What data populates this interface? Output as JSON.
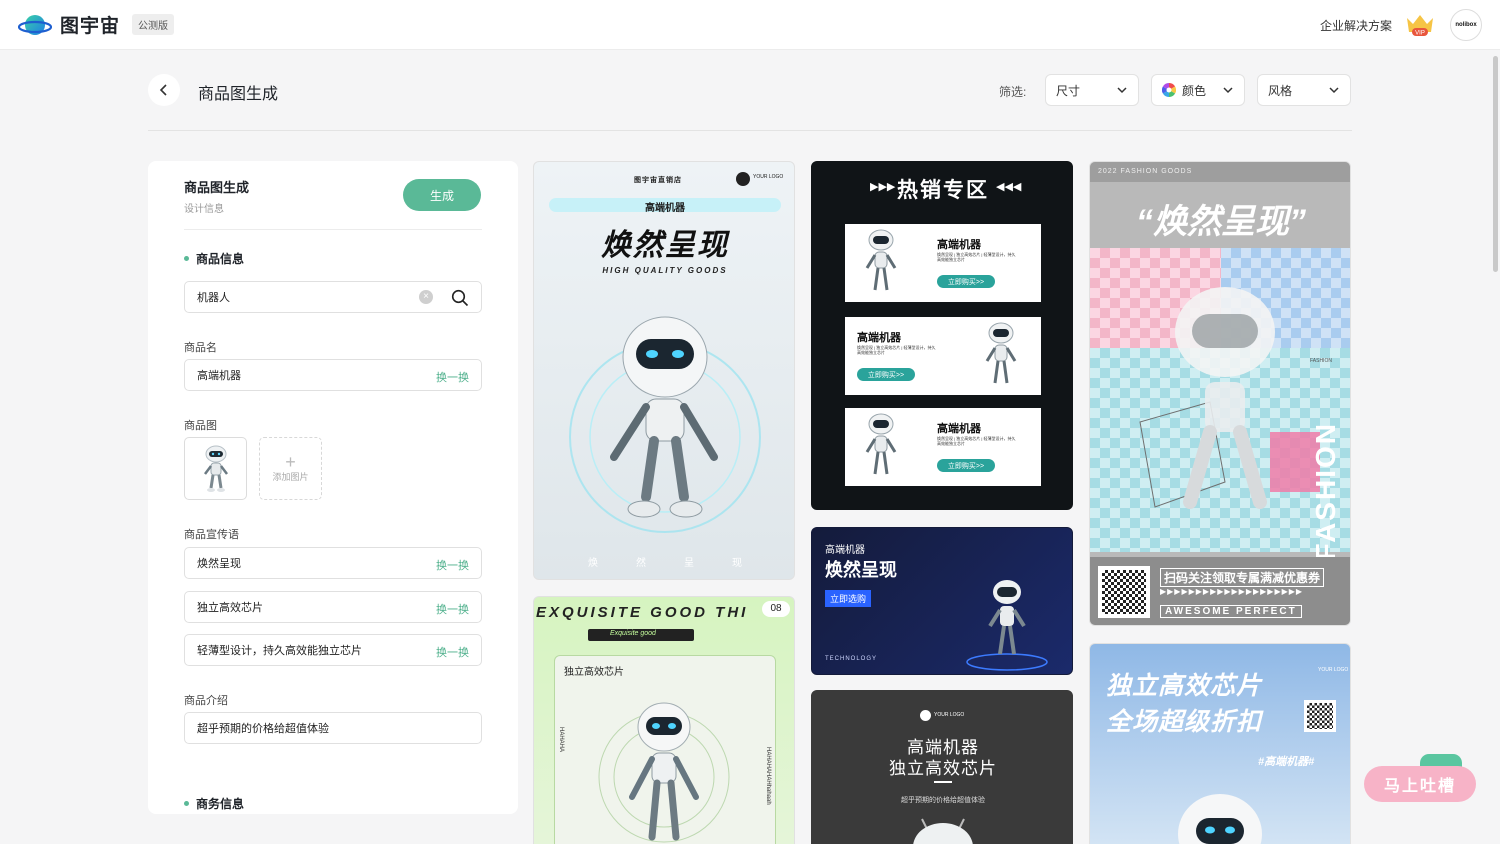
{
  "nav": {
    "logo_text": "图宇宙",
    "badge": "公测版",
    "enterprise": "企业解决方案",
    "vip_label": "VIP",
    "avatar_text": "nolibox"
  },
  "header": {
    "title": "商品图生成",
    "filter_label": "筛选:",
    "filters": [
      "尺寸",
      "颜色",
      "风格"
    ]
  },
  "panel": {
    "title": "商品图生成",
    "subtitle": "设计信息",
    "generate": "生成",
    "section_product": "商品信息",
    "search_value": "机器人",
    "name_label": "商品名",
    "name_value": "高端机器",
    "swap": "换一换",
    "image_label": "商品图",
    "add_image": "添加图片",
    "slogan_label": "商品宣传语",
    "slogans": [
      "焕然呈现",
      "独立高效芯片",
      "轻薄型设计，持久高效能独立芯片"
    ],
    "intro_label": "商品介绍",
    "intro_value": "超乎预期的价格给超值体验",
    "section_business": "商务信息"
  },
  "cards": {
    "c1": {
      "shop": "图宇宙直销店",
      "logo": "YOUR LOGO",
      "name": "高端机器",
      "headline": "焕然呈现",
      "tagline": "HIGH QUALITY GOODS",
      "footer": [
        "焕",
        "然",
        "呈",
        "现"
      ]
    },
    "c2": {
      "banner": "热销专区",
      "name": "高端机器",
      "desc": "焕然呈现 | 独立高效芯片 | 轻薄型设计，持久高效能独立芯片",
      "cta": "立即购买>>"
    },
    "c3": {
      "year": "2022 FASHION GOODS",
      "headline": "“焕然呈现”",
      "side": "FASHION",
      "small": "FASHION",
      "scan": "扫码关注领取专属满减优惠券",
      "arrows": "▶▶▶▶▶▶▶▶▶▶▶▶▶▶▶▶▶▶▶▶",
      "footer": "AWESOME PERFECT"
    },
    "c4": {
      "marquee": "EXQUISITE GOOD THI",
      "counter": "08",
      "tag": "Exquisite good",
      "label": "独立高效芯片",
      "side_left": "HAHAHA",
      "side_right": "HAHAHAHAHhahaah"
    },
    "c5": {
      "name": "高端机器",
      "headline": "焕然呈现",
      "cta": "立即选购",
      "footer": "TECHNOLOGY"
    },
    "c6": {
      "logo": "YOUR LOGO",
      "line1": "高端机器",
      "line2": "独立高效芯片",
      "desc": "超乎预期的价格给超值体验"
    },
    "c7": {
      "line1": "独立高效芯片",
      "line2": "全场超级折扣",
      "tag": "#高端机器#",
      "logo": "YOUR LOGO"
    }
  },
  "feedback": "马上吐槽"
}
